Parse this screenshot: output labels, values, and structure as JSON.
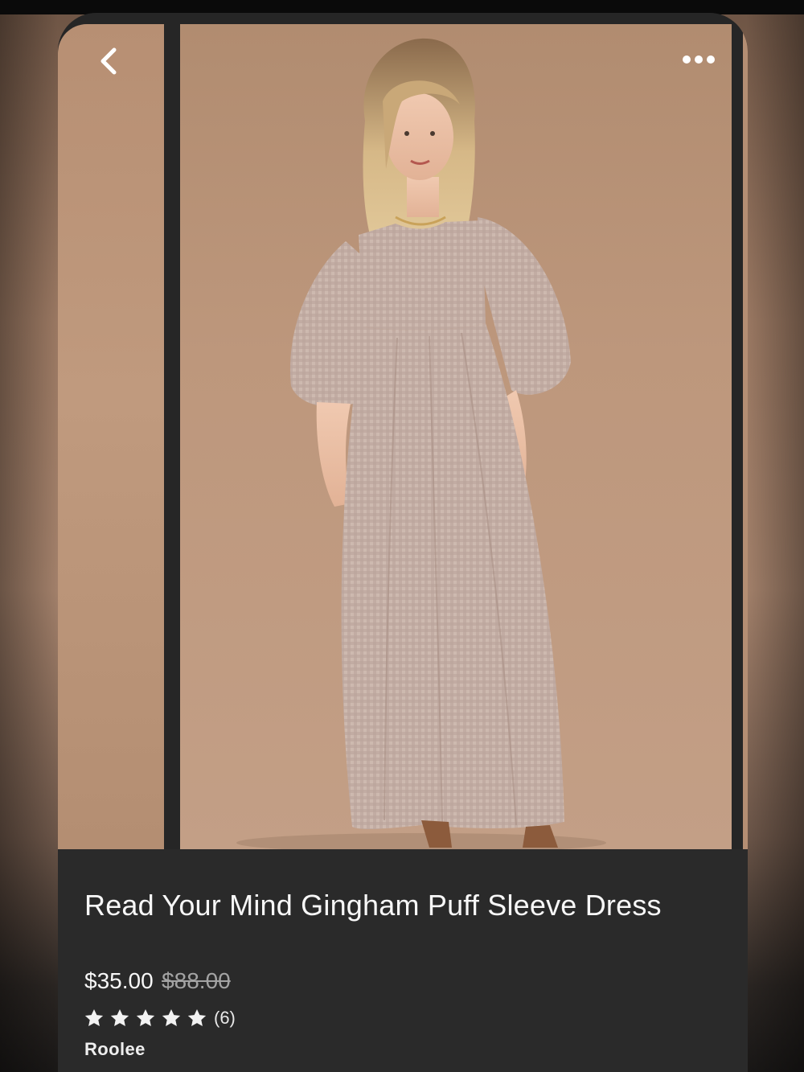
{
  "product": {
    "title": "Read Your Mind Gingham Puff Sleeve Dress",
    "price": "$35.00",
    "original_price": "$88.00",
    "rating": 5,
    "rating_count": "(6)",
    "seller": "Roolee"
  },
  "icons": {
    "back": "chevron-left-icon",
    "more": "ellipsis-icon",
    "star": "star-icon"
  },
  "colors": {
    "background": "#2a2a2a",
    "text": "#f7f7f7",
    "muted": "#a3a3a3",
    "photo_backdrop": "#b8927a",
    "dress": "#c6b1a6"
  }
}
